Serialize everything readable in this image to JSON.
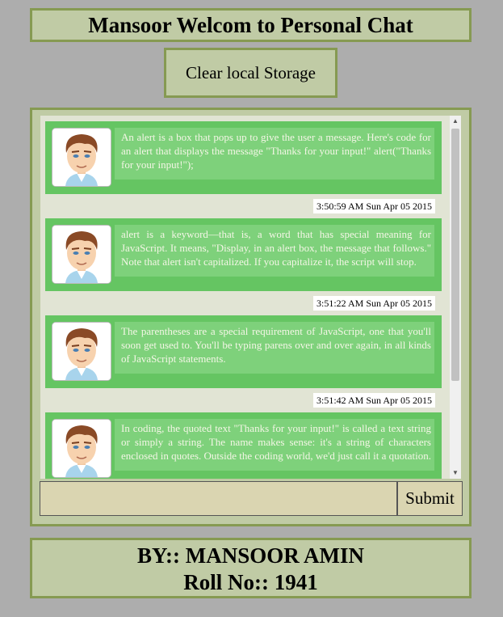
{
  "header": {
    "title": "Mansoor Welcom to Personal Chat"
  },
  "clear_button": {
    "label": "Clear local Storage"
  },
  "chat": {
    "messages": [
      {
        "text": "An alert is a box that pops up to give the user a message. Here's code for an alert that displays the message \"Thanks for your input!\" alert(\"Thanks for your input!\");",
        "timestamp": "3:50:59 AM Sun Apr 05 2015"
      },
      {
        "text": "alert is a keyword—that is, a word that has special meaning for JavaScript. It means, \"Display, in an alert box, the message that follows.\" Note that alert isn't capitalized. If you capitalize it, the script will stop.",
        "timestamp": "3:51:22 AM Sun Apr 05 2015"
      },
      {
        "text": "The parentheses are a special requirement of JavaScript, one that you'll soon get used to. You'll be typing parens over and over again, in all kinds of JavaScript statements.",
        "timestamp": "3:51:42 AM Sun Apr 05 2015"
      },
      {
        "text": "In coding, the quoted text \"Thanks for your input!\" is called a text string or simply a string. The name makes sense: it's a string of characters enclosed in quotes. Outside the coding world, we'd just call it a quotation.",
        "timestamp": ""
      }
    ],
    "input": {
      "value": "",
      "placeholder": ""
    },
    "submit_label": "Submit"
  },
  "footer": {
    "line1": "BY:: MANSOOR AMIN",
    "line2": "Roll No:: 1941"
  },
  "colors": {
    "background": "#adadad",
    "panel": "#c0cba5",
    "panel_border": "#869a52",
    "message": "#65c562",
    "bubble": "#7ed17b"
  },
  "icons": {
    "avatar": "user-avatar-icon",
    "scroll_up": "arrow-up-icon",
    "scroll_down": "arrow-down-icon"
  }
}
